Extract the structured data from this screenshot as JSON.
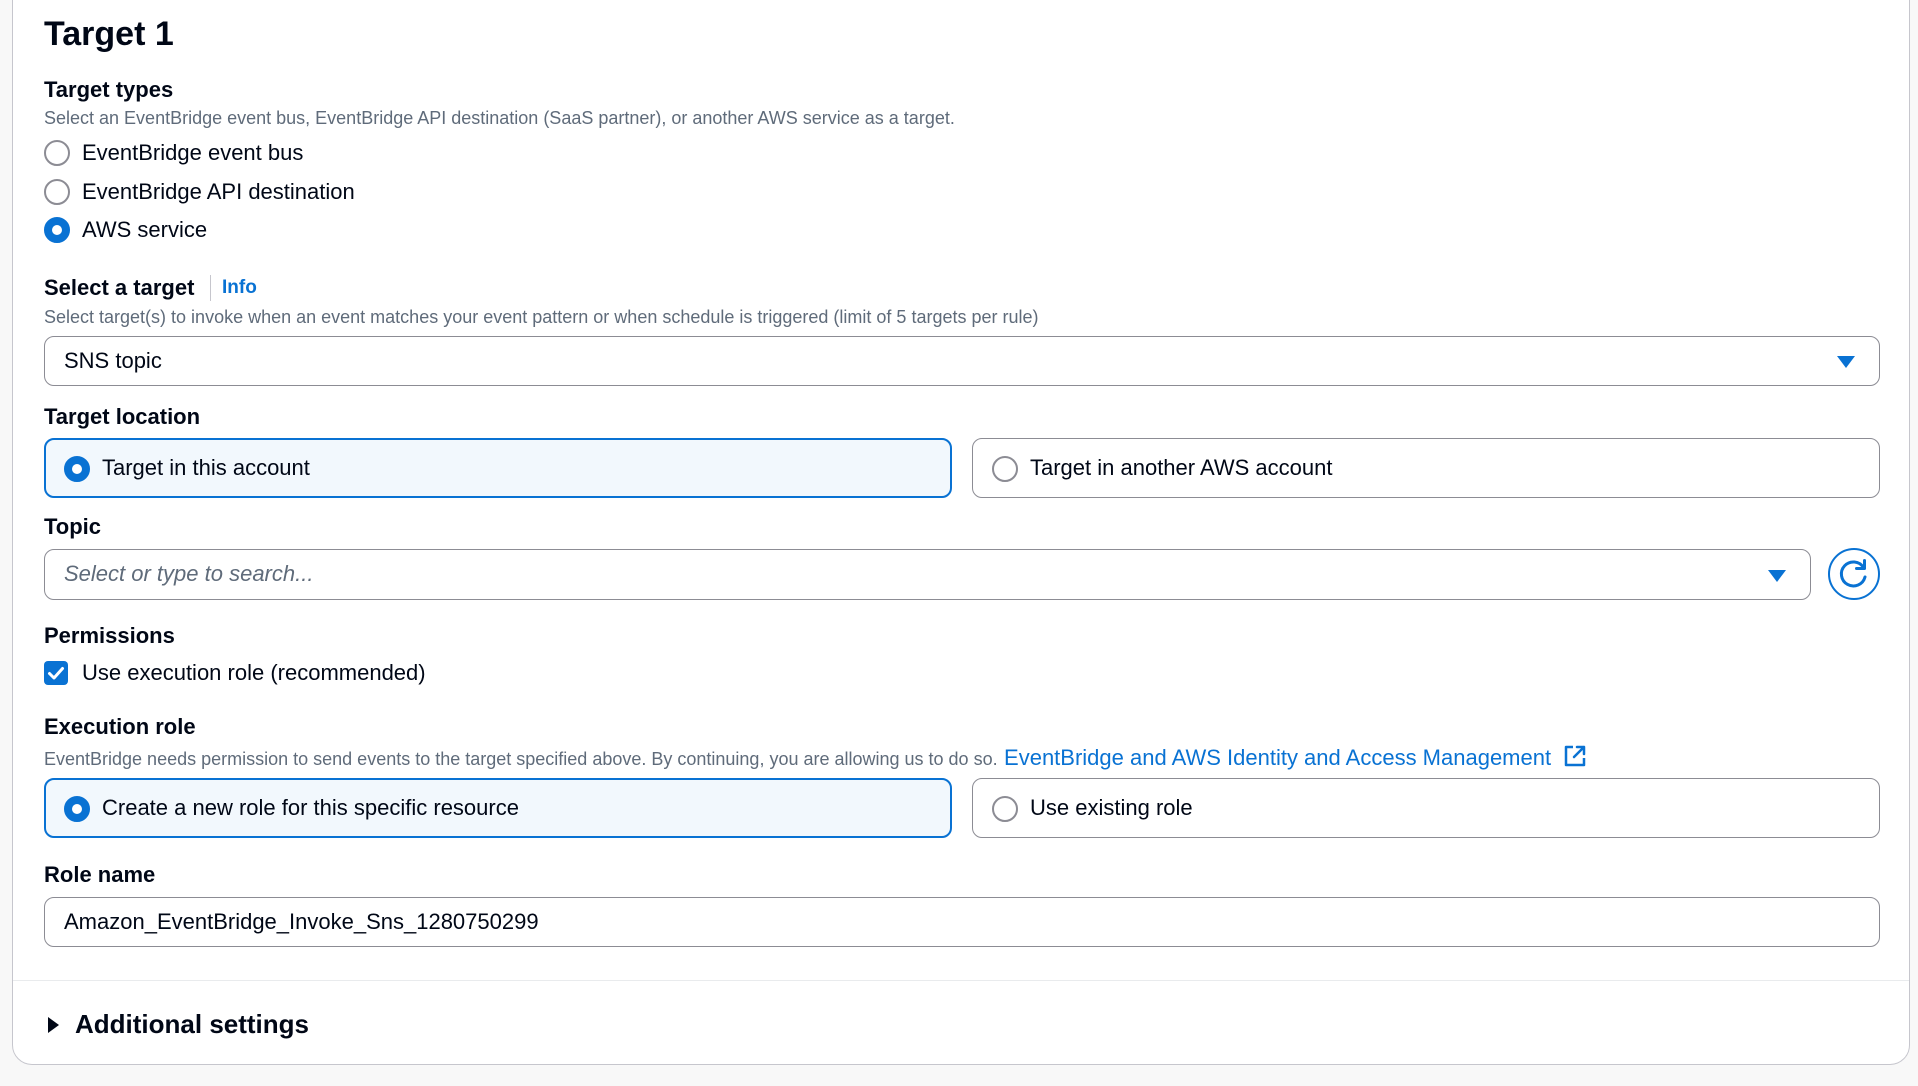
{
  "section": {
    "title": "Target 1"
  },
  "target_types": {
    "label": "Target types",
    "description": "Select an EventBridge event bus, EventBridge API destination (SaaS partner), or another AWS service as a target.",
    "options": [
      {
        "label": "EventBridge event bus",
        "selected": false
      },
      {
        "label": "EventBridge API destination",
        "selected": false
      },
      {
        "label": "AWS service",
        "selected": true
      }
    ]
  },
  "select_target": {
    "label": "Select a target",
    "info": "Info",
    "description": "Select target(s) to invoke when an event matches your event pattern or when schedule is triggered (limit of 5 targets per rule)",
    "value": "SNS topic"
  },
  "target_location": {
    "label": "Target location",
    "options": [
      {
        "label": "Target in this account",
        "selected": true
      },
      {
        "label": "Target in another AWS account",
        "selected": false
      }
    ]
  },
  "topic": {
    "label": "Topic",
    "placeholder": "Select or type to search..."
  },
  "permissions": {
    "label": "Permissions",
    "checkbox_label": "Use execution role (recommended)",
    "checked": true
  },
  "execution_role": {
    "label": "Execution role",
    "description": "EventBridge needs permission to send events to the target specified above. By continuing, you are allowing us to do so.",
    "link": "EventBridge and AWS Identity and Access Management",
    "options": [
      {
        "label": "Create a new role for this specific resource",
        "selected": true
      },
      {
        "label": "Use existing role",
        "selected": false
      }
    ]
  },
  "role_name": {
    "label": "Role name",
    "value": "Amazon_EventBridge_Invoke_Sns_1280750299"
  },
  "additional_settings": {
    "label": "Additional settings"
  },
  "colors": {
    "accent": "#0972d3",
    "text": "#000716",
    "secondary_text": "#5f6b7a",
    "border": "#8c8c94"
  }
}
